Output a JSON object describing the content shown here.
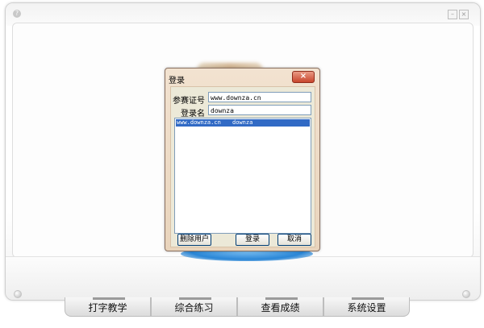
{
  "app": {
    "help_glyph": "?",
    "minimize_glyph": "–",
    "close_glyph": "×"
  },
  "dialog": {
    "title": "登录",
    "close_glyph": "×",
    "exam_id_label": "参赛证号",
    "exam_id_value": "www.downza.cn",
    "login_name_label": "登录名",
    "login_name_value": "downza",
    "users": [
      {
        "exam_id": "www.downza.cn",
        "login_name": "downza"
      }
    ],
    "delete_user_label": "删除用户",
    "login_label": "登录",
    "cancel_label": "取消"
  },
  "nav": {
    "tabs": [
      {
        "label": "打字教学"
      },
      {
        "label": "综合练习"
      },
      {
        "label": "查看成绩"
      },
      {
        "label": "系统设置"
      }
    ]
  }
}
